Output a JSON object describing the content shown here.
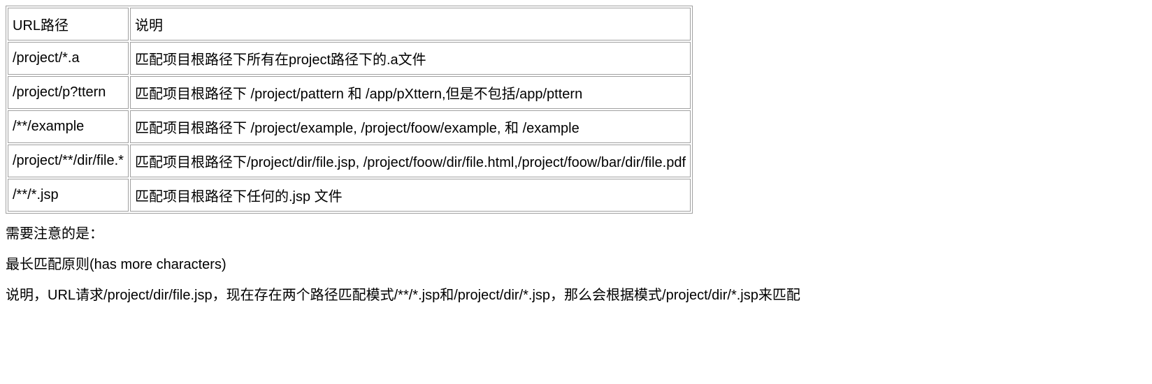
{
  "table": {
    "header": {
      "col1": "URL路径",
      "col2": "说明"
    },
    "rows": [
      {
        "path": "/project/*.a",
        "desc": "匹配项目根路径下所有在project路径下的.a文件"
      },
      {
        "path": "/project/p?ttern",
        "desc": "匹配项目根路径下 /project/pattern 和 /app/pXttern,但是不包括/app/pttern"
      },
      {
        "path": "/**/example",
        "desc": "匹配项目根路径下 /project/example, /project/foow/example, 和 /example"
      },
      {
        "path": "/project/**/dir/file.*",
        "desc": "匹配项目根路径下/project/dir/file.jsp, /project/foow/dir/file.html,/project/foow/bar/dir/file.pdf"
      },
      {
        "path": "/**/*.jsp",
        "desc": "匹配项目根路径下任何的.jsp 文件"
      }
    ]
  },
  "notes": {
    "p1": "需要注意的是：",
    "p2": "最长匹配原则(has more characters)",
    "p3": "说明，URL请求/project/dir/file.jsp，现在存在两个路径匹配模式/**/*.jsp和/project/dir/*.jsp，那么会根据模式/project/dir/*.jsp来匹配"
  }
}
